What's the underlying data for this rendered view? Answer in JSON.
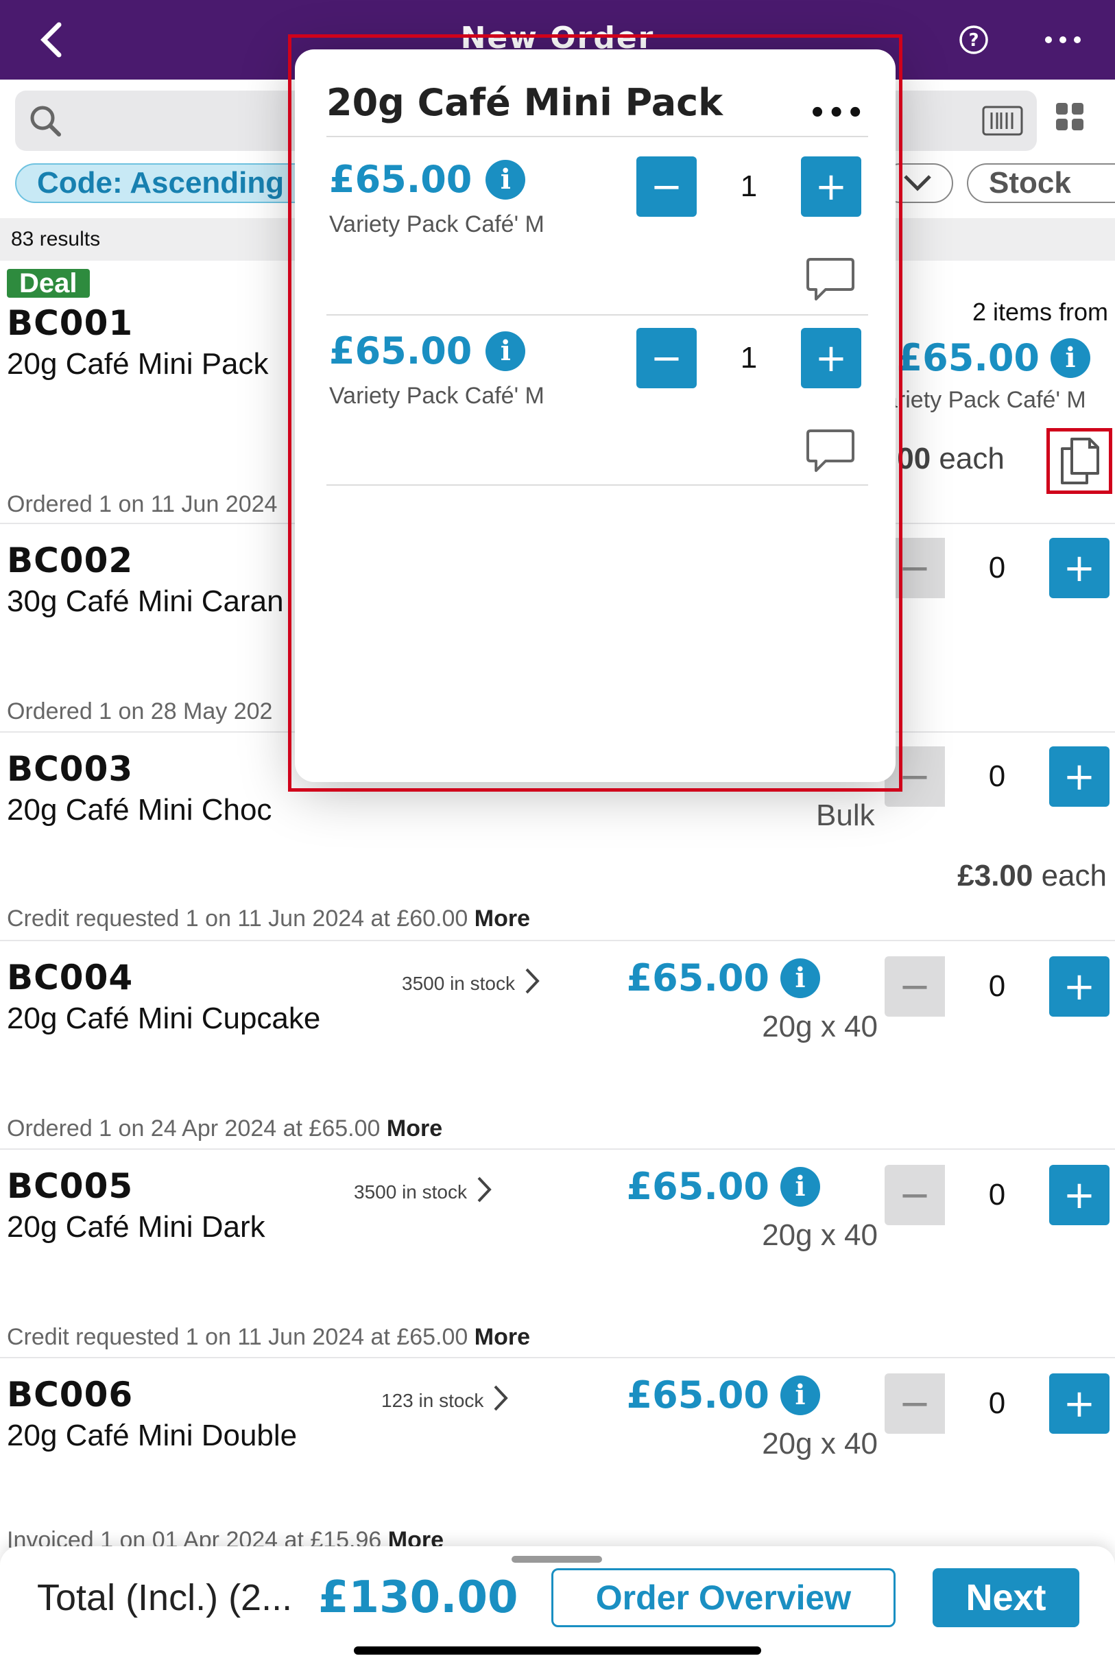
{
  "header": {
    "title": "New Order"
  },
  "search": {
    "placeholder": ""
  },
  "chips": {
    "sort": "Code: Ascending",
    "stock": "Stock"
  },
  "results": "83 results",
  "deal_label": "Deal",
  "products": [
    {
      "code": "BC001",
      "name": "20g Café Mini Pack",
      "items_from": "2 items from",
      "price": "£65.00",
      "variety": "ariety Pack Café' M",
      "each_price": ".00",
      "each_label": " each",
      "history": "Ordered 1 on 11 Jun 2024"
    },
    {
      "code": "BC002",
      "name": "30g Café Mini Caran",
      "qty": "0",
      "history": "Ordered 1 on 28 May 202"
    },
    {
      "code": "BC003",
      "name": "20g Café Mini Choc",
      "qty": "0",
      "pack": "Bulk",
      "each_price": "£3.00",
      "each_label": " each",
      "history": "Credit requested 1 on 11 Jun 2024 at £60.00",
      "more": "More"
    },
    {
      "code": "BC004",
      "name": "20g Café Mini Cupcake",
      "stock": "3500 in stock",
      "price": "£65.00",
      "pack": "20g x 40",
      "qty": "0",
      "history": "Ordered 1 on 24 Apr 2024 at £65.00",
      "more": "More"
    },
    {
      "code": "BC005",
      "name": "20g Café Mini Dark",
      "stock": "3500 in stock",
      "price": "£65.00",
      "pack": "20g x 40",
      "qty": "0",
      "history": "Credit requested 1 on 11 Jun 2024 at £65.00",
      "more": "More"
    },
    {
      "code": "BC006",
      "name": "20g Café Mini Double",
      "stock": "123 in stock",
      "price": "£65.00",
      "pack": "20g x 40",
      "qty": "0",
      "history": "Invoiced 1 on 01 Apr 2024 at £15.96",
      "more": "More"
    }
  ],
  "modal": {
    "title": "20g Café Mini Pack",
    "items": [
      {
        "price": "£65.00",
        "variety": "Variety Pack Café' M",
        "qty": "1"
      },
      {
        "price": "£65.00",
        "variety": "Variety Pack Café' M",
        "qty": "1"
      }
    ]
  },
  "footer": {
    "total_label": "Total (Incl.) (2...",
    "total_value": "£130.00",
    "overview": "Order Overview",
    "next": "Next"
  },
  "colors": {
    "brand": "#4a1a6e",
    "accent": "#1a8fc2",
    "deal": "#2e8b3e",
    "highlight": "#d0021b"
  }
}
